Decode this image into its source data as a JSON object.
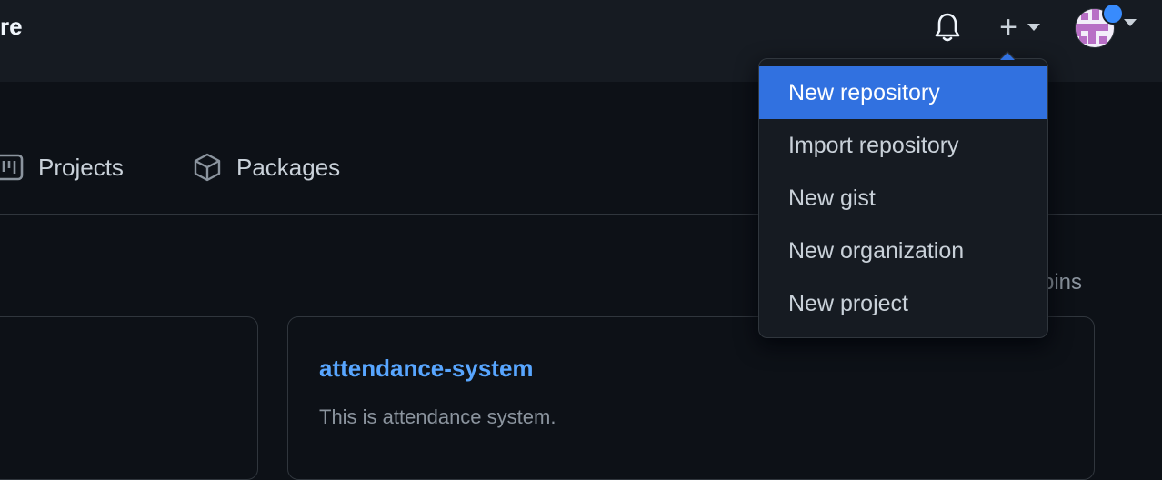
{
  "header": {
    "title": "re",
    "icons": {
      "notifications": "bell-icon",
      "create": "plus-icon",
      "avatar": "avatar-icon"
    }
  },
  "nav": {
    "projects_label": "Projects",
    "packages_label": "Packages"
  },
  "pins": {
    "text": "pins"
  },
  "repo_card": {
    "name": "attendance-system",
    "description": "This is attendance system."
  },
  "create_menu": {
    "items": [
      {
        "label": "New repository",
        "active": true
      },
      {
        "label": "Import repository"
      },
      {
        "label": "New gist"
      },
      {
        "label": "New organization"
      },
      {
        "label": "New project"
      }
    ]
  },
  "colors": {
    "accent": "#3171e0",
    "link": "#58a6ff",
    "notification_dot": "#388bfd",
    "avatar": "#b86fc6"
  }
}
